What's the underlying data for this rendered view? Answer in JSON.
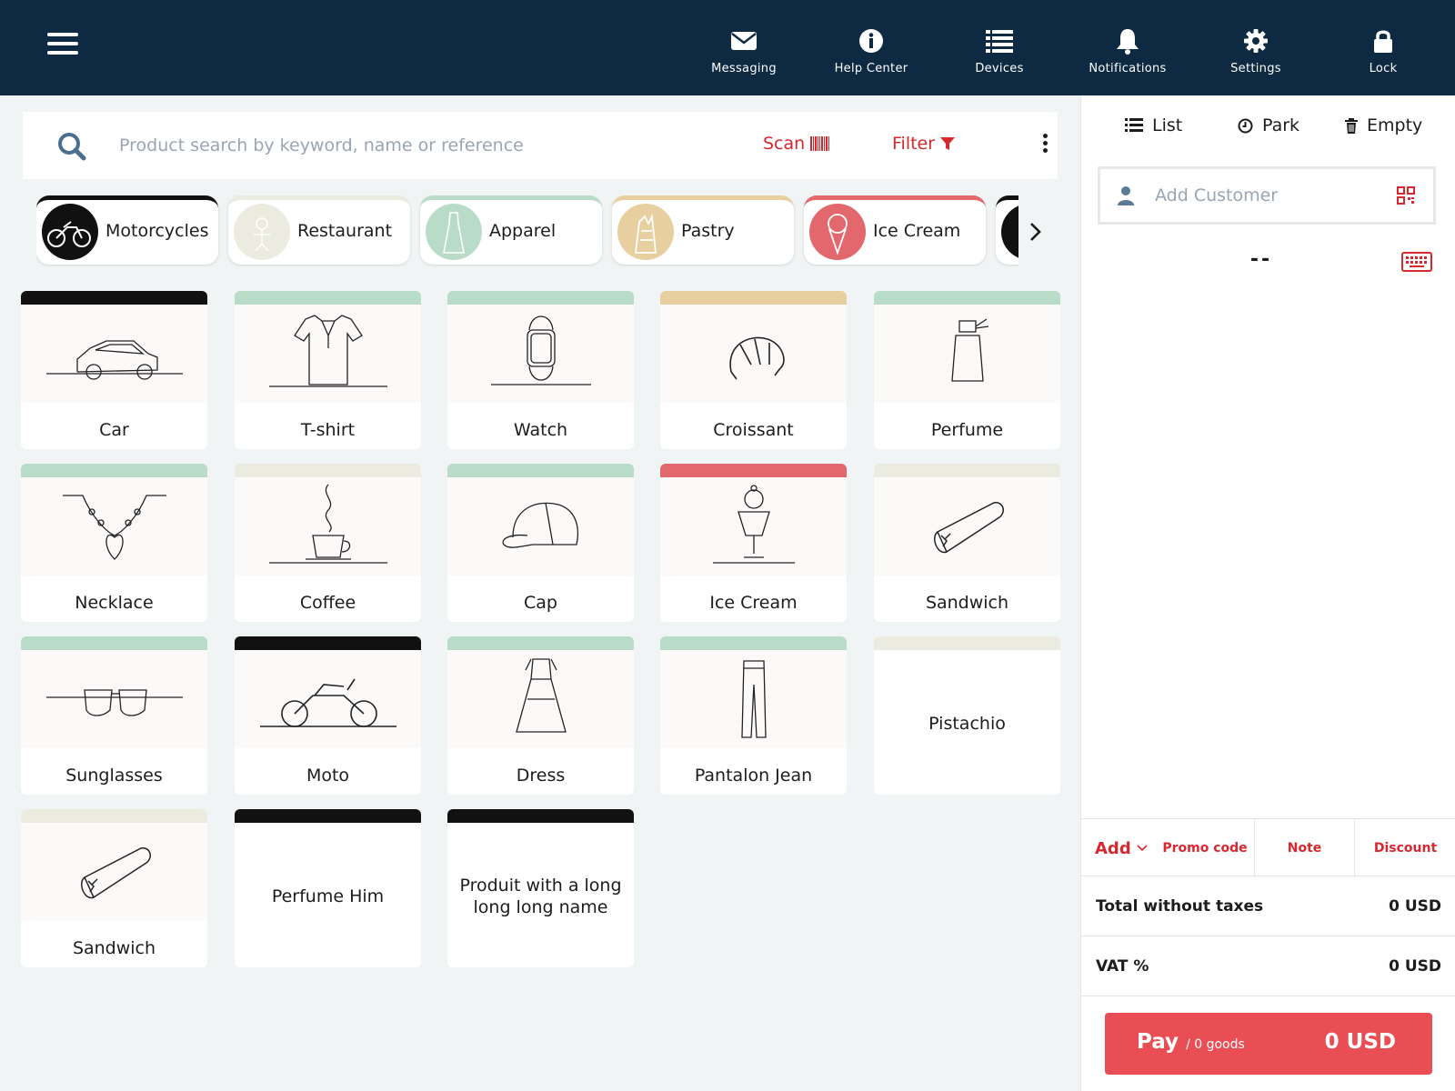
{
  "topbar": {
    "nav": [
      {
        "label": "Messaging",
        "icon": "envelope-icon"
      },
      {
        "label": "Help Center",
        "icon": "info-icon"
      },
      {
        "label": "Devices",
        "icon": "list-icon"
      },
      {
        "label": "Notifications",
        "icon": "bell-icon"
      },
      {
        "label": "Settings",
        "icon": "gear-icon"
      },
      {
        "label": "Lock",
        "icon": "lock-icon"
      }
    ]
  },
  "search": {
    "placeholder": "Product search by keyword, name or reference",
    "scan_label": "Scan",
    "filter_label": "Filter"
  },
  "categories": [
    {
      "label": "Motorcycles",
      "color": "#111111"
    },
    {
      "label": "Restaurant",
      "color": "#ecebdf"
    },
    {
      "label": "Apparel",
      "color": "#b9dcc8"
    },
    {
      "label": "Pastry",
      "color": "#e8cf9f"
    },
    {
      "label": "Ice Cream",
      "color": "#e3686d"
    }
  ],
  "products": [
    {
      "name": "Car",
      "color": "#111111",
      "icon": "car-icon"
    },
    {
      "name": "T-shirt",
      "color": "#b9dcc8",
      "icon": "tshirt-icon"
    },
    {
      "name": "Watch",
      "color": "#b9dcc8",
      "icon": "watch-icon"
    },
    {
      "name": "Croissant",
      "color": "#e8cf9f",
      "icon": "croissant-icon"
    },
    {
      "name": "Perfume",
      "color": "#b9dcc8",
      "icon": "perfume-icon"
    },
    {
      "name": "Necklace",
      "color": "#b9dcc8",
      "icon": "necklace-icon"
    },
    {
      "name": "Coffee",
      "color": "#ecebdf",
      "icon": "coffee-icon"
    },
    {
      "name": "Cap",
      "color": "#b9dcc8",
      "icon": "cap-icon"
    },
    {
      "name": "Ice Cream",
      "color": "#e3686d",
      "icon": "ice-cream-icon"
    },
    {
      "name": "Sandwich",
      "color": "#ecebdf",
      "icon": "sandwich-icon"
    },
    {
      "name": "Sunglasses",
      "color": "#b9dcc8",
      "icon": "sunglasses-icon"
    },
    {
      "name": "Moto",
      "color": "#111111",
      "icon": "motorcycle-icon"
    },
    {
      "name": "Dress",
      "color": "#b9dcc8",
      "icon": "dress-icon"
    },
    {
      "name": "Pantalon Jean",
      "color": "#b9dcc8",
      "icon": "jeans-icon"
    },
    {
      "name": "Pistachio",
      "color": "#ecebdf",
      "icon": ""
    },
    {
      "name": "Sandwich",
      "color": "#ecebdf",
      "icon": "sandwich-icon"
    },
    {
      "name": "Perfume Him",
      "color": "#111111",
      "icon": ""
    },
    {
      "name": "Produit with a long long long name",
      "color": "#111111",
      "icon": ""
    }
  ],
  "cart": {
    "tabs": {
      "list": "List",
      "park": "Park",
      "empty": "Empty"
    },
    "customer_placeholder": "Add Customer",
    "ticket_placeholder": "--",
    "actions": {
      "add": "Add",
      "promo": "Promo code",
      "note": "Note",
      "discount": "Discount"
    },
    "total_label": "Total without taxes",
    "total_value": "0 USD",
    "vat_label": "VAT %",
    "vat_value": "0 USD",
    "pay_label": "Pay",
    "pay_sub": "/ 0 goods",
    "pay_amount": "0 USD"
  },
  "colors": {
    "topbar": "#0e2a43",
    "accent": "#d6282e",
    "pay": "#e84e53"
  }
}
